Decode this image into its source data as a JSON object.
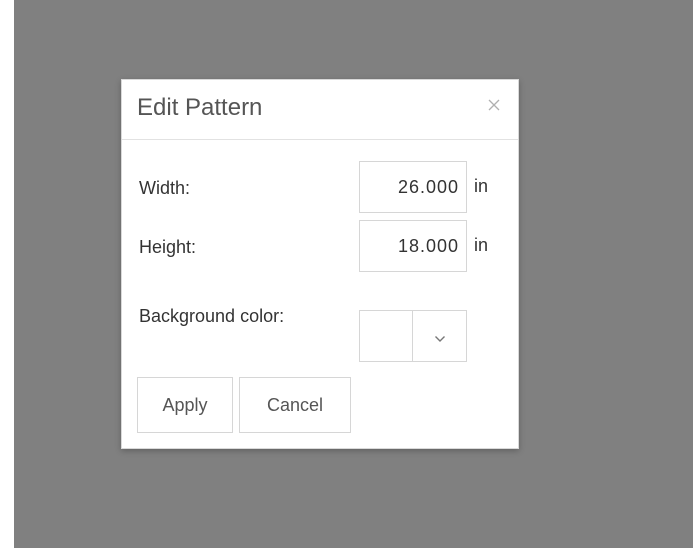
{
  "dialog": {
    "title": "Edit Pattern",
    "close_icon": "close-icon"
  },
  "fields": {
    "width": {
      "label": "Width:",
      "value": "26.000",
      "unit": "in"
    },
    "height": {
      "label": "Height:",
      "value": "18.000",
      "unit": "in"
    },
    "background_color": {
      "label": "Background color:",
      "value": "#ffffff",
      "dropdown_icon": "chevron-down-icon"
    }
  },
  "buttons": {
    "apply": "Apply",
    "cancel": "Cancel"
  },
  "colors": {
    "overlay": "#808080",
    "dialog_bg": "#ffffff",
    "border": "#d6d6d6"
  }
}
